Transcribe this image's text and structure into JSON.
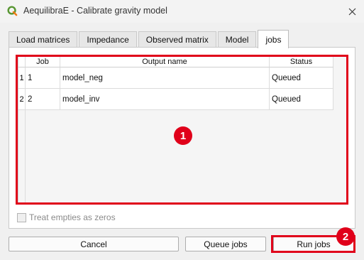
{
  "window": {
    "title": "AequilibraE - Calibrate gravity model"
  },
  "tabs": [
    {
      "label": "Load matrices"
    },
    {
      "label": "Impedance"
    },
    {
      "label": "Observed matrix"
    },
    {
      "label": "Model"
    },
    {
      "label": "jobs"
    }
  ],
  "table": {
    "columns": [
      "Job",
      "Output name",
      "Status"
    ],
    "rows": [
      {
        "row_header": "1",
        "job": "1",
        "output_name": "model_neg",
        "status": "Queued"
      },
      {
        "row_header": "2",
        "job": "2",
        "output_name": "model_inv",
        "status": "Queued"
      }
    ]
  },
  "options": {
    "treat_empties_label": "Treat empties as zeros"
  },
  "buttons": {
    "cancel": "Cancel",
    "queue_jobs": "Queue jobs",
    "run_jobs": "Run jobs"
  },
  "annotations": {
    "badge1": "1",
    "badge2": "2",
    "color": "#e0001a"
  }
}
